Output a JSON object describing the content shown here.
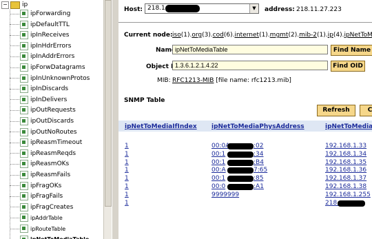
{
  "tree": {
    "root_label": "ip",
    "items": [
      {
        "label": "ipForwarding"
      },
      {
        "label": "ipDefaultTTL"
      },
      {
        "label": "ipInReceives"
      },
      {
        "label": "ipInHdrErrors"
      },
      {
        "label": "ipInAddrErrors"
      },
      {
        "label": "ipForwDatagrams"
      },
      {
        "label": "ipInUnknownProtos"
      },
      {
        "label": "ipInDiscards"
      },
      {
        "label": "ipInDelivers"
      },
      {
        "label": "ipOutRequests"
      },
      {
        "label": "ipOutDiscards"
      },
      {
        "label": "ipOutNoRoutes"
      },
      {
        "label": "ipReasmTimeout"
      },
      {
        "label": "ipReasmReqds"
      },
      {
        "label": "ipReasmOKs"
      },
      {
        "label": "ipReasmFails"
      },
      {
        "label": "ipFragOKs"
      },
      {
        "label": "ipFragFails"
      },
      {
        "label": "ipFragCreates"
      },
      {
        "label": "ipAddrTable"
      },
      {
        "label": "ipRouteTable"
      },
      {
        "label": "ipNetToMediaTable"
      }
    ]
  },
  "host": {
    "label": "Host:",
    "value": "218.1",
    "address_label": "address:",
    "address_value": "218.11.27.223"
  },
  "node": {
    "current_label": "Current node:",
    "path": [
      {
        "text": "iso",
        "suffix": "(1)."
      },
      {
        "text": "org",
        "suffix": "(3)."
      },
      {
        "text": "cod",
        "suffix": "(6)."
      },
      {
        "text": "internet",
        "suffix": "(1)."
      },
      {
        "text": "mgmt",
        "suffix": "(2)."
      },
      {
        "text": "mib-2",
        "suffix": "(1)."
      },
      {
        "text": "ip",
        "suffix": "(4)."
      },
      {
        "text": "ipNetToMediaTab",
        "suffix": ""
      }
    ],
    "name_label": "Name:",
    "name_value": "ipNetToMediaTable",
    "find_name": "Find Name",
    "oid_label": "Object ID:",
    "oid_value": "1.3.6.1.2.1.4.22",
    "find_oid": "Find OID",
    "mib_label": "MIB:",
    "mib_link": "RFC1213-MIB",
    "mib_file": "[file name: rfc1213.mib]"
  },
  "snmp": {
    "title": "SNMP Table",
    "refresh": "Refresh",
    "c_button": "C",
    "columns": [
      "ipNetToMediaIfIndex",
      "ipNetToMediaPhysAddress",
      "ipNetToMediaNetAddress"
    ],
    "rows": [
      {
        "index": "1",
        "phys": "00:0A",
        "phys_end": ":02",
        "net": "192.168.1.33"
      },
      {
        "index": "1",
        "phys": "00:1",
        "phys_end": ":34",
        "net": "192.168.1.34"
      },
      {
        "index": "1",
        "phys": "00:1",
        "phys_end": ":B4",
        "net": "192.168.1.35"
      },
      {
        "index": "1",
        "phys": "00:A",
        "phys_end": "7:65",
        "net": "192.168.1.36"
      },
      {
        "index": "1",
        "phys": "00:1",
        "phys_end": ":85",
        "net": "192.168.1.37"
      },
      {
        "index": "1",
        "phys": "00:0",
        "phys_end": ":A1",
        "net": "192.168.1.38"
      },
      {
        "index": "1",
        "phys": "9999999",
        "phys_end": "",
        "net": "192.168.1.255"
      },
      {
        "index": "1",
        "phys": "",
        "phys_end": "",
        "net": "218."
      }
    ]
  }
}
